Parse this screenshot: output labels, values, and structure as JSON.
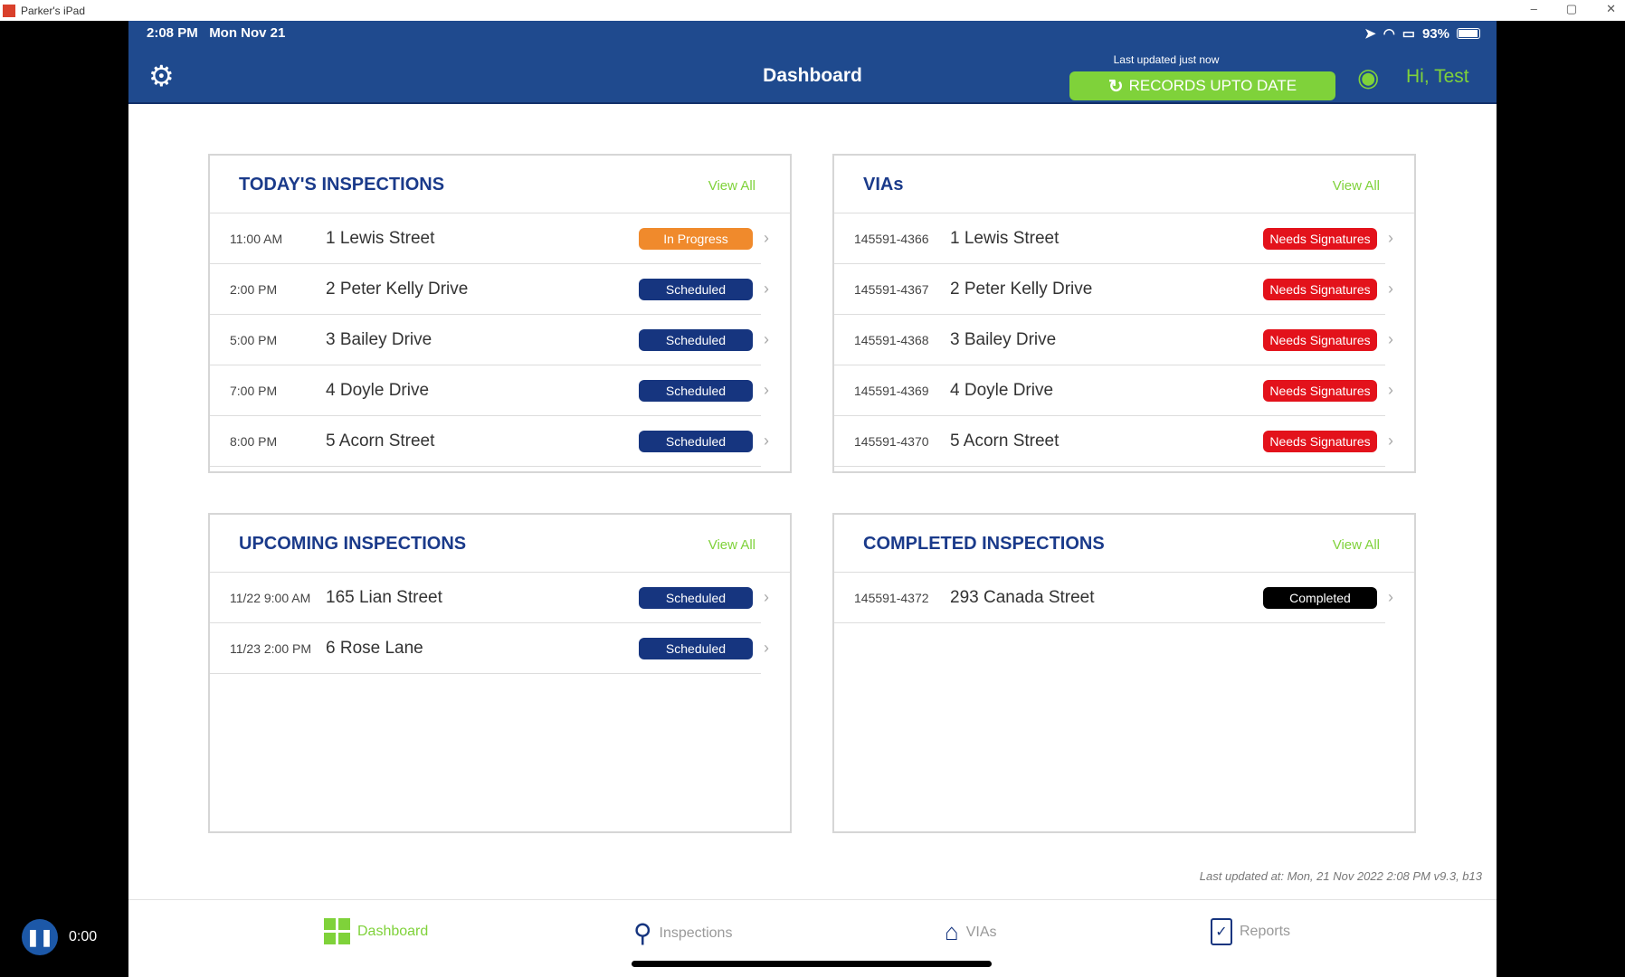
{
  "window": {
    "title": "Parker's iPad",
    "min": "–",
    "restore": "▢",
    "close": "✕"
  },
  "status": {
    "time": "2:08 PM   Mon Nov 21",
    "battery": "93%"
  },
  "header": {
    "title": "Dashboard",
    "last_updated": "Last updated just now",
    "records_button": "RECORDS UPTO DATE",
    "greeting": "Hi, Test"
  },
  "colors": {
    "primary": "#1f4a8e",
    "accent": "#7fd23a",
    "in_progress": "#f08a2c",
    "scheduled": "#16357f",
    "needs_signatures": "#e3121b",
    "completed": "#000000"
  },
  "today": {
    "title": "TODAY'S INSPECTIONS",
    "view_all": "View All",
    "rows": [
      {
        "time": "11:00 AM",
        "address": "1 Lewis Street",
        "status": "In Progress",
        "kind": "in_progress"
      },
      {
        "time": "2:00 PM",
        "address": "2 Peter Kelly Drive",
        "status": "Scheduled",
        "kind": "scheduled"
      },
      {
        "time": "5:00 PM",
        "address": "3 Bailey Drive",
        "status": "Scheduled",
        "kind": "scheduled"
      },
      {
        "time": "7:00 PM",
        "address": "4 Doyle Drive",
        "status": "Scheduled",
        "kind": "scheduled"
      },
      {
        "time": "8:00 PM",
        "address": "5 Acorn Street",
        "status": "Scheduled",
        "kind": "scheduled"
      }
    ]
  },
  "vias": {
    "title": "VIAs",
    "view_all": "View All",
    "rows": [
      {
        "time": "145591-4366",
        "address": "1 Lewis Street",
        "status": "Needs Signatures",
        "kind": "needs_signatures"
      },
      {
        "time": "145591-4367",
        "address": "2 Peter Kelly Drive",
        "status": "Needs Signatures",
        "kind": "needs_signatures"
      },
      {
        "time": "145591-4368",
        "address": "3 Bailey Drive",
        "status": "Needs Signatures",
        "kind": "needs_signatures"
      },
      {
        "time": "145591-4369",
        "address": "4 Doyle Drive",
        "status": "Needs Signatures",
        "kind": "needs_signatures"
      },
      {
        "time": "145591-4370",
        "address": "5 Acorn Street",
        "status": "Needs Signatures",
        "kind": "needs_signatures"
      }
    ]
  },
  "upcoming": {
    "title": "UPCOMING INSPECTIONS",
    "view_all": "View All",
    "rows": [
      {
        "time": "11/22 9:00 AM",
        "address": "165 Lian Street",
        "status": "Scheduled",
        "kind": "scheduled"
      },
      {
        "time": "11/23 2:00 PM",
        "address": "6 Rose Lane",
        "status": "Scheduled",
        "kind": "scheduled"
      }
    ]
  },
  "completed": {
    "title": "COMPLETED INSPECTIONS",
    "view_all": "View All",
    "rows": [
      {
        "time": "145591-4372",
        "address": "293 Canada Street",
        "status": "Completed",
        "kind": "completed"
      }
    ]
  },
  "footer": "Last updated at: Mon, 21 Nov 2022 2:08 PM v9.3, b13",
  "tabs": [
    {
      "label": "Dashboard",
      "icon": "grid-icon",
      "active": true
    },
    {
      "label": "Inspections",
      "icon": "inspector-icon"
    },
    {
      "label": "VIAs",
      "icon": "house-award-icon"
    },
    {
      "label": "Reports",
      "icon": "checklist-icon"
    }
  ],
  "player": {
    "time": "0:00"
  }
}
